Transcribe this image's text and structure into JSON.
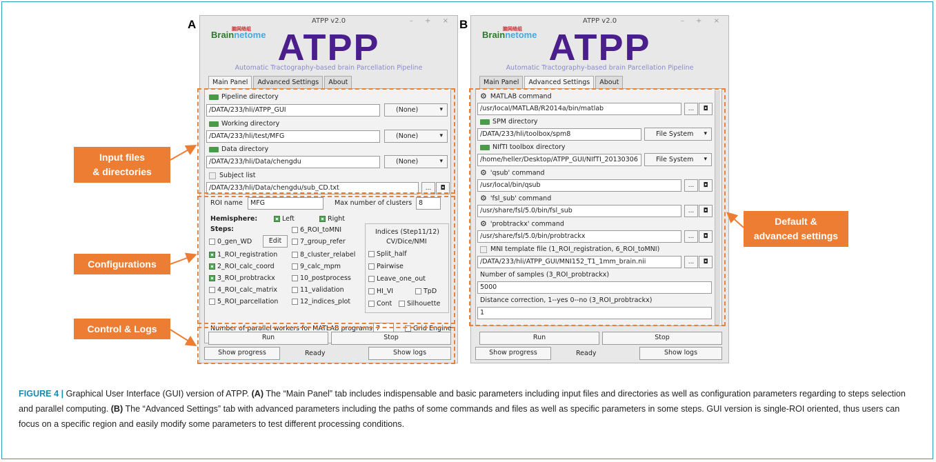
{
  "labels": {
    "a": "A",
    "b": "B"
  },
  "window": {
    "title": "ATPP v2.0",
    "controls": "– + ×",
    "logo_brand_a": "Brain",
    "logo_brand_b": "netome",
    "logo_cn": "脑网络组",
    "big_title": "ATPP",
    "subtitle": "Automatic Tractography-based brain Parcellation Pipeline"
  },
  "tabs": {
    "main": "Main Panel",
    "advanced": "Advanced Settings",
    "about": "About"
  },
  "main": {
    "pipeline_label": "Pipeline  directory",
    "pipeline_value": "/DATA/233/hli/ATPP_GUI",
    "pipeline_combo": "(None)",
    "working_label": "Working  directory",
    "working_value": "/DATA/233/hli/test/MFG",
    "working_combo": "(None)",
    "data_label": "Data  directory",
    "data_value": "/DATA/233/hli/Data/chengdu",
    "data_combo": "(None)",
    "subject_label": "Subject list",
    "subject_value": "/DATA/233/hli/Data/chengdu/sub_CD.txt",
    "browse": "...",
    "icon": "◘",
    "roi_label": "ROI name",
    "roi_value": "MFG",
    "clusters_label": "Max number of clusters",
    "clusters_value": "8",
    "hemisphere": "Hemisphere:",
    "left": "Left",
    "right": "Right",
    "steps": "Steps:",
    "step0": "0_gen_WD",
    "edit": "Edit",
    "step1": "1_ROI_registration",
    "step2": "2_ROI_calc_coord",
    "step3": "3_ROI_probtrackx",
    "step4": "4_ROI_calc_matrix",
    "step5": "5_ROI_parcellation",
    "step6": "6_ROI_toMNI",
    "step7": "7_group_refer",
    "step8": "8_cluster_relabel",
    "step9": "9_calc_mpm",
    "step10": "10_postprocess",
    "step11": "11_validation",
    "step12": "12_indices_plot",
    "indices_title1": "Indices (Step11/12)",
    "indices_title2": "CV/Dice/NMI",
    "split_half": "Split_half",
    "pairwise": "Pairwise",
    "loo": "Leave_one_out",
    "hivi": "HI_VI",
    "tpd": "TpD",
    "cont": "Cont",
    "silhouette": "Silhouette",
    "workers_label": "Number of parallel workers for MATLAB programs",
    "workers_value": "7",
    "grid_engine": "Grid Engine",
    "run": "Run",
    "stop": "Stop",
    "show_progress": "Show progress",
    "status": "Ready",
    "show_logs": "Show logs"
  },
  "advanced": {
    "matlab_label": "MATLAB command",
    "matlab_value": "/usr/local/MATLAB/R2014a/bin/matlab",
    "spm_label": "SPM  directory",
    "spm_value": "/DATA/233/hli/toolbox/spm8",
    "fs": "File System",
    "nifti_label": "NIfTI toolbox  directory",
    "nifti_value": "/home/heller/Desktop/ATPP_GUI/NIfTI_20130306",
    "qsub_label": "'qsub' command",
    "qsub_value": "/usr/local/bin/qsub",
    "fslsub_label": "'fsl_sub' command",
    "fslsub_value": "/usr/share/fsl/5.0/bin/fsl_sub",
    "probtrackx_label": "'probtrackx' command",
    "probtrackx_value": "/usr/share/fsl/5.0/bin/probtrackx",
    "mni_label": "MNI template file  (1_ROI_registration, 6_ROI_toMNI)",
    "mni_value": "/DATA/233/hli/ATPP_GUI/MNI152_T1_1mm_brain.nii",
    "samples_label": "Number of samples (3_ROI_probtrackx)",
    "samples_value": "5000",
    "distance_label": "Distance correction, 1--yes  0--no (3_ROI_probtrackx)",
    "distance_value": "1"
  },
  "callouts": {
    "input": "Input files\n& directories",
    "config": "Configurations",
    "control": "Control & Logs",
    "default": "Default &\nadvanced settings"
  },
  "caption": {
    "fig": "FIGURE 4 |",
    "p1": " Graphical User Interface (GUI) version of ATPP. ",
    "a": "(A)",
    "p2": " The “Main Panel” tab includes indispensable and basic parameters including input files and directories as well as configuration parameters regarding to steps selection and parallel computing. ",
    "b": "(B)",
    "p3": " The “Advanced Settings” tab with advanced parameters including the paths of some commands and files as well as specific parameters in some steps. GUI version is single-ROI oriented, thus users can focus on a specific region and easily modify some parameters to test different processing conditions."
  },
  "colors": {
    "accent": "#ec7d33",
    "title": "#4a1f8c",
    "frame": "#2c9fb5"
  }
}
